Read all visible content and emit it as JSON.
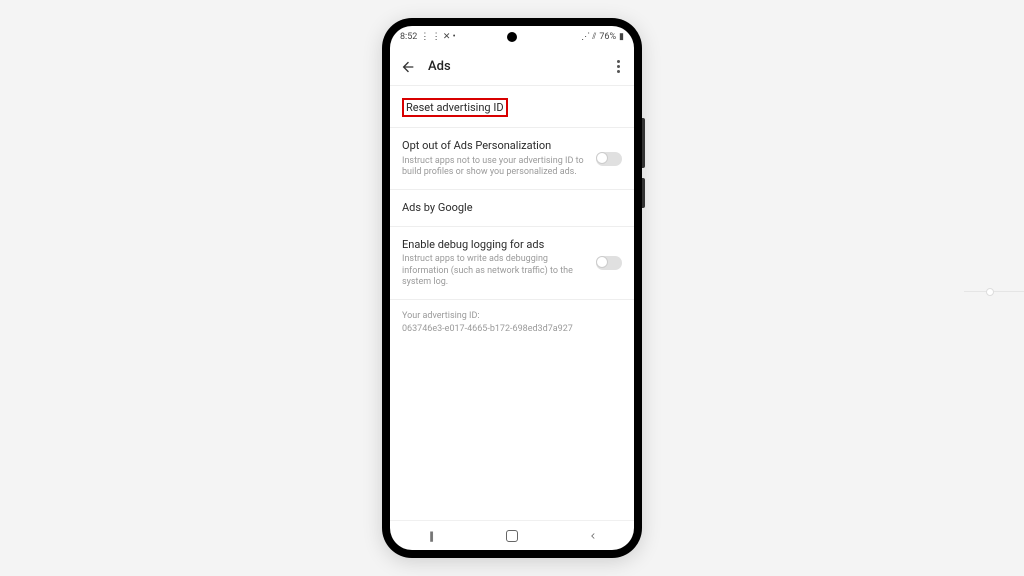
{
  "statusbar": {
    "time": "8:52",
    "left_icons": "⋮ ⋮ ✕ •",
    "signal": "⋰ ⫽",
    "battery": "76%",
    "battery_icon": "▮"
  },
  "appbar": {
    "title": "Ads"
  },
  "rows": {
    "reset": {
      "title": "Reset advertising ID"
    },
    "optout": {
      "title": "Opt out of Ads Personalization",
      "sub": "Instruct apps not to use your advertising ID to build profiles or show you personalized ads."
    },
    "adsby": {
      "title": "Ads by Google"
    },
    "debug": {
      "title": "Enable debug logging for ads",
      "sub": "Instruct apps to write ads debugging information (such as network traffic) to the system log."
    }
  },
  "adid": {
    "label": "Your advertising ID:",
    "value": "063746e3-e017-4665-b172-698ed3d7a927"
  }
}
